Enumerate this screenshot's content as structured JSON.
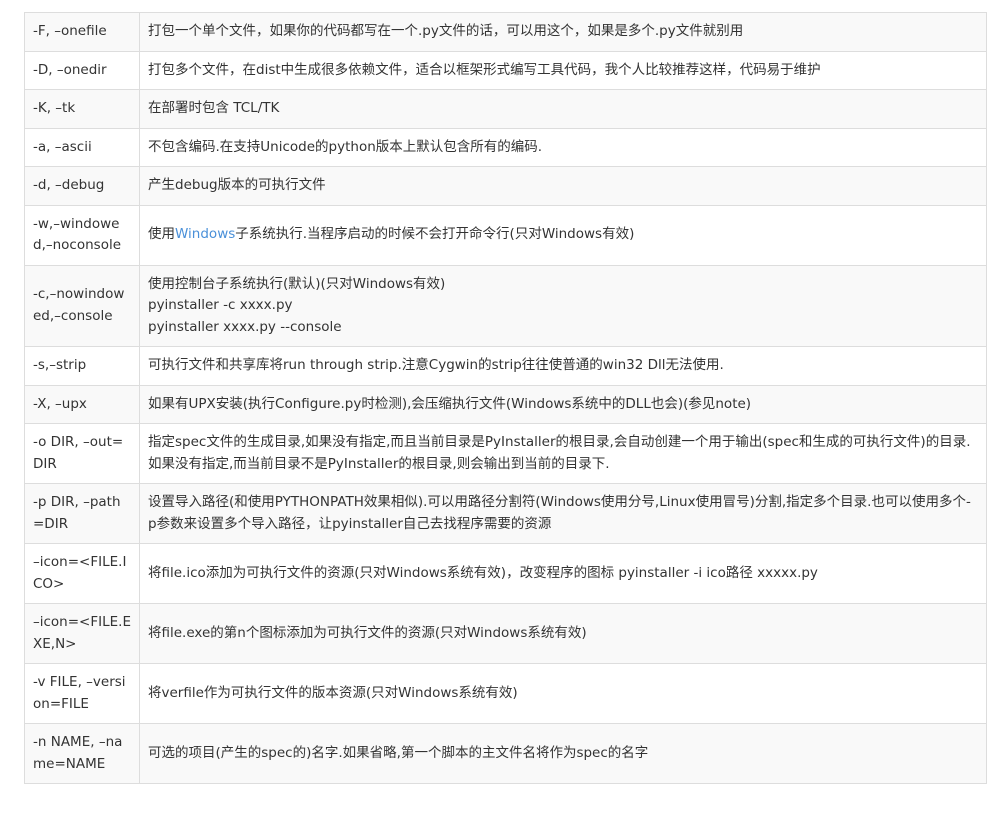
{
  "rows": [
    {
      "option": "-F, –onefile",
      "desc": [
        "打包一个单个文件，如果你的代码都写在一个.py文件的话，可以用这个，如果是多个.py文件就别用"
      ]
    },
    {
      "option": "-D, –onedir",
      "desc": [
        "打包多个文件，在dist中生成很多依赖文件，适合以框架形式编写工具代码，我个人比较推荐这样，代码易于维护"
      ]
    },
    {
      "option": "-K, –tk",
      "desc": [
        "在部署时包含 TCL/TK"
      ]
    },
    {
      "option": "-a, –ascii",
      "desc": [
        "不包含编码.在支持Unicode的python版本上默认包含所有的编码."
      ]
    },
    {
      "option": "-d, –debug",
      "desc": [
        "产生debug版本的可执行文件"
      ]
    },
    {
      "option": "-w,–windowed,–noconsole",
      "desc_prefix": "使用",
      "desc_link": "Windows",
      "desc_suffix": "子系统执行.当程序启动的时候不会打开命令行(只对Windows有效)"
    },
    {
      "option": "-c,–nowindowed,–console",
      "desc": [
        "使用控制台子系统执行(默认)(只对Windows有效)",
        "pyinstaller -c  xxxx.py",
        "pyinstaller xxxx.py --console"
      ]
    },
    {
      "option": "-s,–strip",
      "desc": [
        "可执行文件和共享库将run through strip.注意Cygwin的strip往往使普通的win32 Dll无法使用."
      ]
    },
    {
      "option": "-X, –upx",
      "desc": [
        "如果有UPX安装(执行Configure.py时检测),会压缩执行文件(Windows系统中的DLL也会)(参见note)"
      ]
    },
    {
      "option": "-o DIR, –out=DIR",
      "desc": [
        "指定spec文件的生成目录,如果没有指定,而且当前目录是PyInstaller的根目录,会自动创建一个用于输出(spec和生成的可执行文件)的目录.如果没有指定,而当前目录不是PyInstaller的根目录,则会输出到当前的目录下."
      ]
    },
    {
      "option": "-p DIR, –path=DIR",
      "desc": [
        "设置导入路径(和使用PYTHONPATH效果相似).可以用路径分割符(Windows使用分号,Linux使用冒号)分割,指定多个目录.也可以使用多个-p参数来设置多个导入路径，让pyinstaller自己去找程序需要的资源"
      ]
    },
    {
      "option": "–icon=<FILE.ICO>",
      "desc": [
        "将file.ico添加为可执行文件的资源(只对Windows系统有效)，改变程序的图标  pyinstaller -i  ico路径 xxxxx.py"
      ]
    },
    {
      "option": "–icon=<FILE.EXE,N>",
      "desc": [
        "将file.exe的第n个图标添加为可执行文件的资源(只对Windows系统有效)"
      ]
    },
    {
      "option": "-v FILE, –version=FILE",
      "desc": [
        "将verfile作为可执行文件的版本资源(只对Windows系统有效)"
      ]
    },
    {
      "option": "-n NAME, –name=NAME",
      "desc": [
        "可选的项目(产生的spec的)名字.如果省略,第一个脚本的主文件名将作为spec的名字"
      ]
    }
  ],
  "colors": {
    "border": "#dddddd",
    "stripe": "#f9f9f9",
    "text": "#333333",
    "link": "#4a90d9"
  }
}
